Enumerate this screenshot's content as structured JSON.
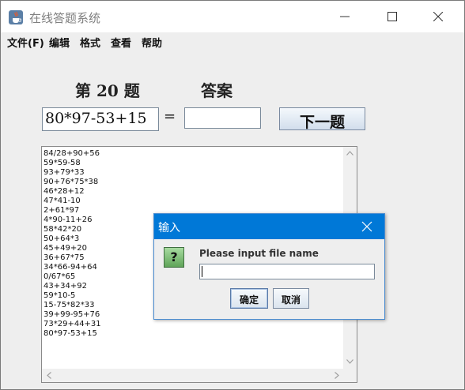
{
  "window": {
    "title": "在线答题系统",
    "icon": "java-cup-icon",
    "controls": [
      "minimize-icon",
      "maximize-icon",
      "close-icon"
    ]
  },
  "menu": {
    "items": [
      {
        "label": "文件(F)"
      },
      {
        "label": "编辑"
      },
      {
        "label": "格式"
      },
      {
        "label": "查看"
      },
      {
        "label": "帮助"
      }
    ]
  },
  "quiz": {
    "question_label": "第 20 题",
    "answer_label": "答案",
    "expression": "80*97-53+15",
    "equals": "=",
    "answer_value": "",
    "next_button": "下一题"
  },
  "history": {
    "lines": [
      "84/28+90+56",
      "59*59-58",
      "93+79*33",
      "90+76*75*38",
      "46*28+12",
      "47*41-10",
      "2+61*97",
      "4*90-11+26",
      "58*42*20",
      "50+64*3",
      "45+49+20",
      "36+67*75",
      "34*66-94+64",
      "0/67*65",
      "43+34+92",
      "59*10-5",
      "15-75*82*33",
      "39+99-95+76",
      "73*29+44+31",
      "80*97-53+15"
    ]
  },
  "dialog": {
    "title": "输入",
    "prompt": "Please input file name",
    "input_value": "",
    "ok_button": "确定",
    "cancel_button": "取消",
    "icon": "question-icon",
    "icon_glyph": "?"
  },
  "colors": {
    "dialog_titlebar": "#0078d7",
    "window_background": "#eeeeee",
    "question_icon": "#6fb366"
  }
}
